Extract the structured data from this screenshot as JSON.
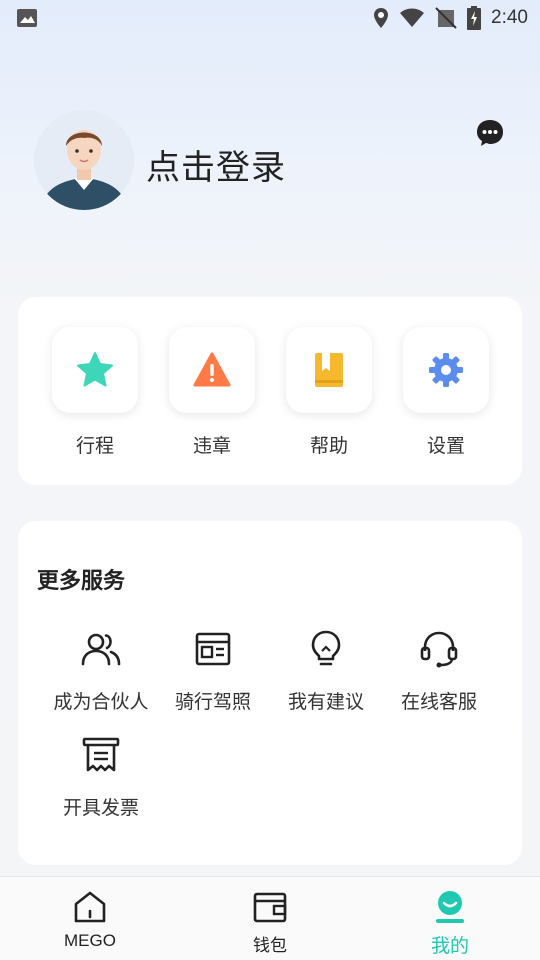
{
  "status_bar": {
    "time": "2:40"
  },
  "profile": {
    "login_text": "点击登录"
  },
  "quick_actions": [
    {
      "label": "行程",
      "icon": "star-icon",
      "color": "#3dd6b8"
    },
    {
      "label": "违章",
      "icon": "warning-icon",
      "color": "#ff7a45"
    },
    {
      "label": "帮助",
      "icon": "book-icon",
      "color": "#f5b82e"
    },
    {
      "label": "设置",
      "icon": "gear-icon",
      "color": "#5b8def"
    }
  ],
  "more_services": {
    "title": "更多服务",
    "items": [
      {
        "label": "成为合伙人",
        "icon": "users-icon"
      },
      {
        "label": "骑行驾照",
        "icon": "license-icon"
      },
      {
        "label": "我有建议",
        "icon": "lightbulb-icon"
      },
      {
        "label": "在线客服",
        "icon": "headset-icon"
      },
      {
        "label": "开具发票",
        "icon": "invoice-icon"
      }
    ]
  },
  "bottom_nav": {
    "items": [
      {
        "label": "MEGO",
        "icon": "home-icon"
      },
      {
        "label": "钱包",
        "icon": "wallet-icon"
      },
      {
        "label": "我的",
        "icon": "profile-icon",
        "active": true
      }
    ],
    "active_color": "#1ec9b0"
  }
}
